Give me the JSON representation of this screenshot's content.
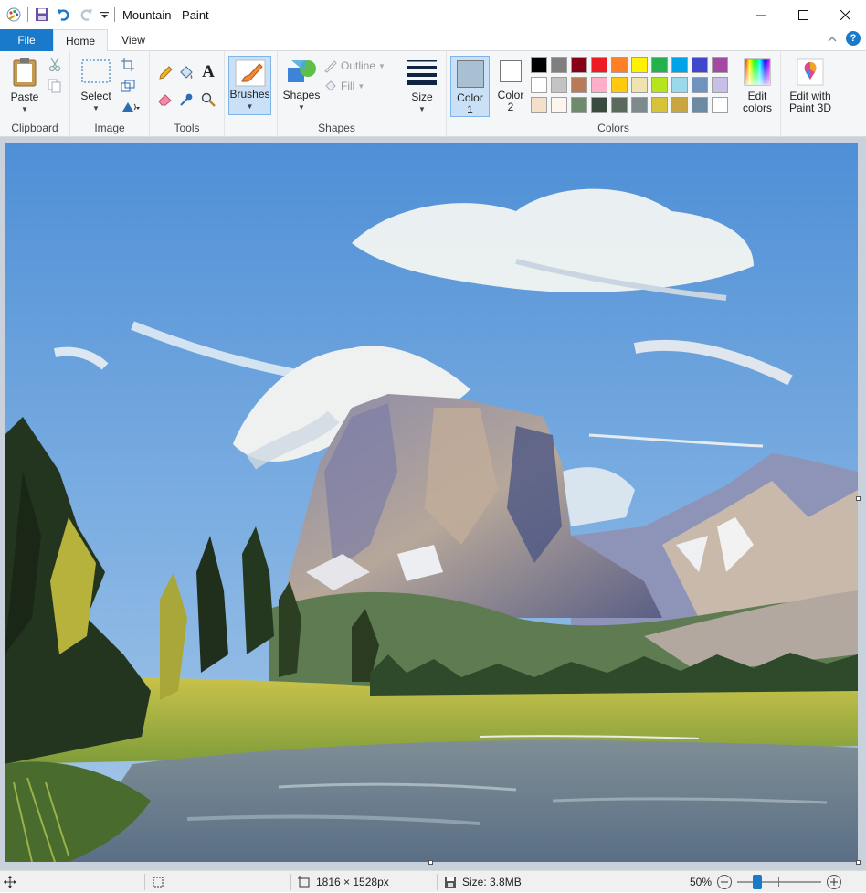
{
  "window": {
    "title": "Mountain - Paint"
  },
  "tabs": {
    "file": "File",
    "home": "Home",
    "view": "View"
  },
  "clipboard": {
    "paste": "Paste",
    "group": "Clipboard"
  },
  "image": {
    "select": "Select",
    "group": "Image"
  },
  "tools": {
    "group": "Tools",
    "text_glyph": "A"
  },
  "brushes": {
    "label": "Brushes"
  },
  "shapes": {
    "label": "Shapes",
    "outline": "Outline",
    "fill": "Fill",
    "group": "Shapes"
  },
  "size": {
    "label": "Size"
  },
  "colors": {
    "color1_line1": "Color",
    "color1_line2": "1",
    "color2_line1": "Color",
    "color2_line2": "2",
    "edit_line1": "Edit",
    "edit_line2": "colors",
    "paint3d_line1": "Edit with",
    "paint3d_line2": "Paint 3D",
    "group": "Colors",
    "color1_value": "#a9bfd2",
    "color2_value": "#ffffff",
    "palette": [
      [
        "#000000",
        "#7f7f7f",
        "#880015",
        "#ed1c24",
        "#ff7f27",
        "#fff200",
        "#22b14c",
        "#00a2e8",
        "#3f48cc",
        "#a349a4"
      ],
      [
        "#ffffff",
        "#c3c3c3",
        "#b97a57",
        "#ffaec9",
        "#ffc90e",
        "#efe4b0",
        "#b5e61d",
        "#99d9ea",
        "#7092be",
        "#c8bfe7"
      ],
      [
        "#f4dfc8",
        "#fdf6ef",
        "#6e8b6d",
        "#3b4a3e",
        "#5a6b5d",
        "#7f8a8f",
        "#d7c33a",
        "#c9a640",
        "#6d8aa3",
        "#ffffff"
      ]
    ]
  },
  "status": {
    "dimensions": "1816 × 1528px",
    "size": "Size: 3.8MB",
    "zoom": "50%"
  }
}
